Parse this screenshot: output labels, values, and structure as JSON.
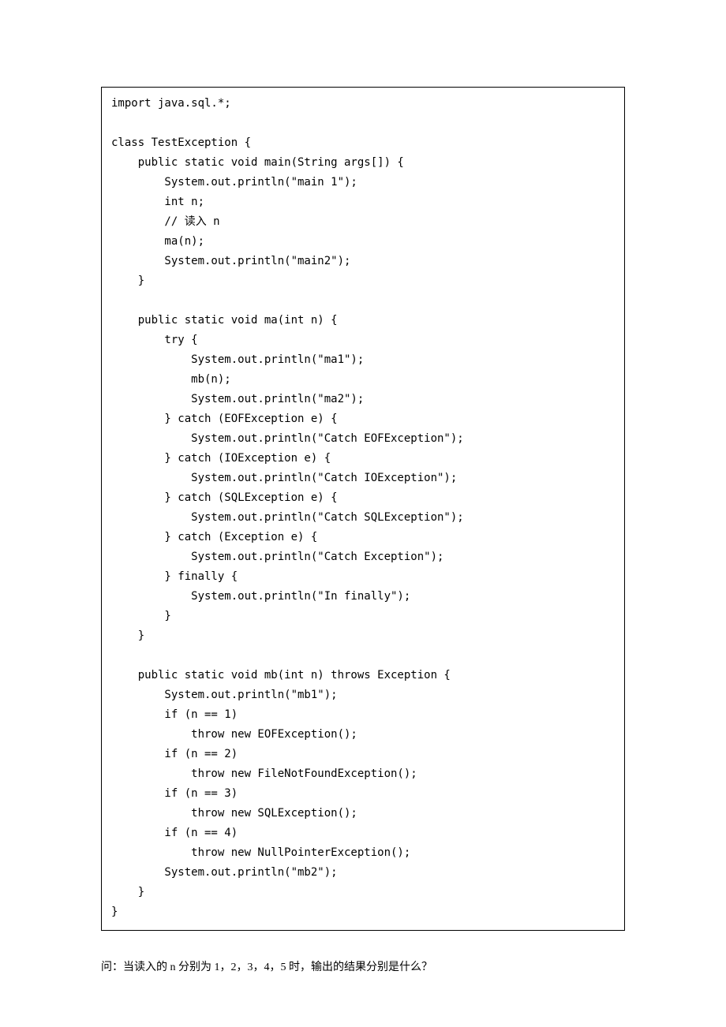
{
  "code": "import java.sql.*;\n\nclass TestException {\n    public static void main(String args[]) {\n        System.out.println(\"main 1\");\n        int n;\n        // 读入 n\n        ma(n);\n        System.out.println(\"main2\");\n    }\n\n    public static void ma(int n) {\n        try {\n            System.out.println(\"ma1\");\n            mb(n);\n            System.out.println(\"ma2\");\n        } catch (EOFException e) {\n            System.out.println(\"Catch EOFException\");\n        } catch (IOException e) {\n            System.out.println(\"Catch IOException\");\n        } catch (SQLException e) {\n            System.out.println(\"Catch SQLException\");\n        } catch (Exception e) {\n            System.out.println(\"Catch Exception\");\n        } finally {\n            System.out.println(\"In finally\");\n        }\n    }\n\n    public static void mb(int n) throws Exception {\n        System.out.println(\"mb1\");\n        if (n == 1)\n            throw new EOFException();\n        if (n == 2)\n            throw new FileNotFoundException();\n        if (n == 3)\n            throw new SQLException();\n        if (n == 4)\n            throw new NullPointerException();\n        System.out.println(\"mb2\");\n    }\n}",
  "question": "问：当读入的 n 分别为 1，2，3，4，5 时，输出的结果分别是什么？"
}
